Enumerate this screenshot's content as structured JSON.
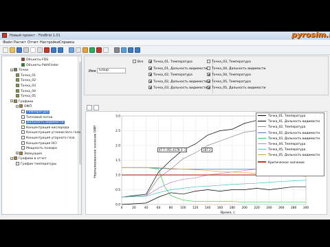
{
  "window": {
    "title": "Новый проект - FireBrid 1.01",
    "watermark": "pyrosim.ru"
  },
  "menu": [
    "Файл",
    "Расчет",
    "Отчет",
    "Настройки",
    "Справка"
  ],
  "toolbar_icons": [
    "new-icon",
    "open-icon",
    "save-icon",
    "cut-icon",
    "copy-icon",
    "paste-icon",
    "delete-icon",
    "undo-icon",
    "redo-icon",
    "grid-icon",
    "table-icon",
    "chart-icon",
    "run-icon",
    "stop-icon",
    "report-icon",
    "settings-icon",
    "zoom-icon",
    "help-icon",
    "info-icon"
  ],
  "tree": [
    {
      "label": "Объекты FDS",
      "depth": 3,
      "icon": "#9b3b2b"
    },
    {
      "label": "Объекты PathFinder",
      "depth": 3,
      "icon": "#2e7d32"
    },
    {
      "label": "Точки",
      "depth": 1,
      "icon": "#7a8a3a",
      "toggle": "−"
    },
    {
      "label": "Точка_01",
      "depth": 2,
      "icon": "#8a9a4a"
    },
    {
      "label": "Точка_02",
      "depth": 2,
      "icon": "#8a9a4a"
    },
    {
      "label": "Точка_03",
      "depth": 2,
      "icon": "#8a9a4a"
    },
    {
      "label": "Точка_04",
      "depth": 2,
      "icon": "#8a9a4a"
    },
    {
      "label": "Точка_05",
      "depth": 2,
      "icon": "#8a9a4a"
    },
    {
      "label": "Графики",
      "depth": 1,
      "icon": "#b8860b",
      "toggle": "−"
    },
    {
      "label": "ОФП",
      "depth": 2,
      "icon": "#b8860b",
      "toggle": "−"
    },
    {
      "label": "Температура",
      "depth": 3,
      "icon": "#ffffff",
      "selected": true
    },
    {
      "label": "Тепловой поток",
      "depth": 3,
      "icon": "#ffffff"
    },
    {
      "label": "Дальность видимости",
      "depth": 3,
      "icon": "#ffffff",
      "selected": true
    },
    {
      "label": "Концентрация кислорода",
      "depth": 3,
      "icon": "#ffffff"
    },
    {
      "label": "Концентрация углекислого газа",
      "depth": 3,
      "icon": "#ffffff"
    },
    {
      "label": "Концентрация угарного газа",
      "depth": 3,
      "icon": "#ffffff"
    },
    {
      "label": "Концентрация HCl",
      "depth": 3,
      "icon": "#ffffff"
    },
    {
      "label": "Мощность пожара",
      "depth": 3,
      "icon": "#ffffff"
    },
    {
      "label": "Эвакуация",
      "depth": 2,
      "icon": "#b8860b",
      "toggle": "+"
    },
    {
      "label": "Графики в отчет",
      "depth": 1,
      "icon": "#b8860b",
      "toggle": "−"
    },
    {
      "label": "График температуры",
      "depth": 2,
      "icon": "#ffffff"
    }
  ],
  "props": {
    "all_label": "Все",
    "name_label": "Имя",
    "name_value": "Group",
    "checkboxes": [
      {
        "label": "Точка_01, Температура",
        "checked": true
      },
      {
        "label": "Точка_01, Дальность видимости",
        "checked": true
      },
      {
        "label": "Точка_02, Температура",
        "checked": true
      },
      {
        "label": "Точка_02, Дальность видимости",
        "checked": true
      },
      {
        "label": "Точка_03, Дальность видимости",
        "checked": true
      },
      {
        "label": "Точка_03, Температура",
        "checked": false
      },
      {
        "label": "Точка_04, Дальность видимости",
        "checked": false
      },
      {
        "label": "Точка_04, Температура",
        "checked": true
      },
      {
        "label": "Точка_05, Температура",
        "checked": true
      },
      {
        "label": "Точка_05, Дальность видимости",
        "checked": true
      }
    ]
  },
  "chart_data": {
    "type": "line",
    "xlabel": "Время, с",
    "ylabel": "Нормализованное значение ОФП",
    "xlim": [
      0,
      300
    ],
    "ylim": [
      0,
      3
    ],
    "xticks": [
      0,
      20,
      40,
      60,
      80,
      100,
      120,
      140,
      160,
      180,
      200,
      220,
      240,
      260,
      280,
      300
    ],
    "yticks": [
      0.0,
      0.5,
      1.0,
      1.5,
      2.0,
      2.5,
      3.0
    ],
    "grid": true,
    "legend_position": "top-right",
    "critical": {
      "label": "Критическое значение",
      "value": 1.0,
      "color": "#c0392b"
    },
    "annotations": [
      {
        "text": "47.7: 051.4178.3: 1",
        "x": 58,
        "y": 1.85
      },
      {
        "text": "187.2",
        "x": 130,
        "y": 1.85
      }
    ],
    "series": [
      {
        "name": "Точка_01, Температура",
        "color": "#000000",
        "x": [
          0,
          40,
          60,
          80,
          100,
          120,
          140,
          160,
          180,
          200,
          220,
          240,
          260,
          280,
          300
        ],
        "y": [
          0.25,
          0.35,
          1.1,
          1.5,
          1.85,
          2.05,
          2.35,
          2.5,
          2.55,
          2.75,
          2.85,
          2.95,
          3.0,
          3.05,
          3.1
        ]
      },
      {
        "name": "Точка_01, Дальность видимости",
        "color": "#000000",
        "x": [
          0,
          40,
          60,
          80,
          100,
          120,
          140,
          160,
          180,
          200,
          220,
          240,
          260,
          280,
          300
        ],
        "y": [
          0.0,
          0.05,
          0.25,
          0.4,
          0.35,
          0.45,
          0.5,
          0.45,
          0.5,
          0.5,
          0.55,
          0.5,
          0.55,
          0.6,
          0.6
        ]
      },
      {
        "name": "Точка_02, Температура",
        "color": "#888888",
        "x": [
          0,
          40,
          60,
          80,
          100,
          120,
          140,
          160,
          180,
          200,
          220,
          240,
          260,
          280,
          300
        ],
        "y": [
          0.25,
          0.3,
          0.9,
          1.2,
          1.55,
          1.75,
          2.0,
          2.15,
          2.3,
          2.45,
          2.5,
          2.55,
          2.65,
          2.75,
          2.8
        ]
      },
      {
        "name": "Точка_02, Дальность видимости",
        "color": "#3a7fd0",
        "x": [
          0,
          20,
          40,
          60,
          80,
          100,
          120,
          140,
          160,
          180,
          200,
          220,
          240,
          260,
          280,
          300
        ],
        "y": [
          1.25,
          1.25,
          1.25,
          1.23,
          1.2,
          1.2,
          1.2,
          1.2,
          1.2,
          1.2,
          1.2,
          1.2,
          1.2,
          1.2,
          1.2,
          1.2
        ]
      },
      {
        "name": "Точка_03, Дальность видимости",
        "color": "#2ecc40",
        "x": [
          0,
          20,
          40,
          60,
          70,
          80,
          100,
          120,
          140,
          160,
          180,
          200,
          220,
          240,
          260,
          280,
          300
        ],
        "y": [
          1.25,
          1.25,
          1.25,
          1.2,
          0.6,
          0.3,
          0.15,
          0.1,
          0.1,
          0.1,
          0.1,
          0.08,
          0.08,
          0.08,
          0.08,
          0.08,
          0.08
        ]
      },
      {
        "name": "Точка_04, Температура",
        "color": "#c080c0",
        "x": [
          0,
          40,
          60,
          80,
          100,
          120,
          140,
          160,
          180,
          200,
          220,
          240,
          260,
          280,
          300
        ],
        "y": [
          0.25,
          0.3,
          0.55,
          0.75,
          0.85,
          0.9,
          1.0,
          1.05,
          1.1,
          1.15,
          1.2,
          1.2,
          1.25,
          1.25,
          1.3
        ]
      },
      {
        "name": "Точка_05, Температура",
        "color": "#40c0c0",
        "x": [
          0,
          40,
          60,
          80,
          100,
          120,
          140,
          160,
          180,
          200,
          220,
          240,
          260,
          280,
          300
        ],
        "y": [
          0.25,
          0.28,
          0.4,
          0.5,
          0.55,
          0.6,
          0.62,
          0.65,
          0.68,
          0.7,
          0.72,
          0.75,
          0.78,
          0.8,
          0.82
        ]
      },
      {
        "name": "Точка_05, Дальность видимости",
        "color": "#e0a040",
        "x": [
          0,
          20,
          40,
          60,
          80,
          100,
          120,
          140,
          160,
          180,
          200,
          220,
          240,
          260,
          280,
          300
        ],
        "y": [
          1.25,
          1.25,
          1.25,
          1.25,
          1.22,
          1.2,
          1.18,
          1.15,
          1.12,
          1.1,
          1.08,
          1.05,
          1.02,
          1.0,
          0.98,
          0.95
        ]
      }
    ]
  }
}
